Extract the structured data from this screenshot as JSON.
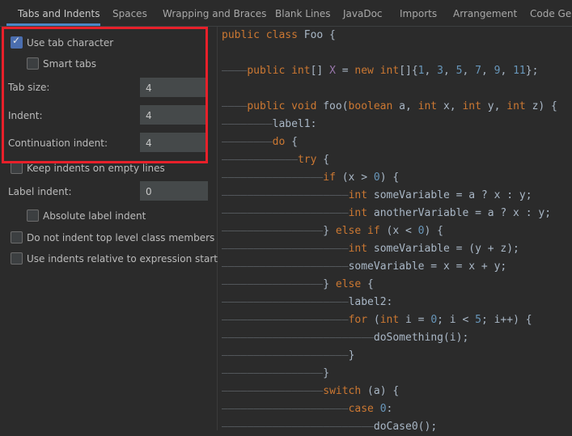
{
  "tabs": [
    {
      "label": "Tabs and Indents",
      "active": true
    },
    {
      "label": "Spaces"
    },
    {
      "label": "Wrapping and Braces"
    },
    {
      "label": "Blank Lines"
    },
    {
      "label": "JavaDoc"
    },
    {
      "label": "Imports"
    },
    {
      "label": "Arrangement"
    },
    {
      "label": "Code Gen"
    }
  ],
  "settings": {
    "use_tab_character": {
      "label": "Use tab character",
      "checked": true
    },
    "smart_tabs": {
      "label": "Smart tabs",
      "checked": false
    },
    "tab_size": {
      "label": "Tab size:",
      "value": "4"
    },
    "indent": {
      "label": "Indent:",
      "value": "4"
    },
    "continuation_indent": {
      "label": "Continuation indent:",
      "value": "4"
    },
    "keep_indents_empty": {
      "label": "Keep indents on empty lines",
      "checked": false
    },
    "label_indent": {
      "label": "Label indent:",
      "value": "0"
    },
    "absolute_label_indent": {
      "label": "Absolute label indent",
      "checked": false
    },
    "no_indent_top_level": {
      "label": "Do not indent top level class members",
      "checked": false
    },
    "indent_relative_expr": {
      "label": "Use indents relative to expression start",
      "checked": false
    }
  },
  "code": {
    "guide": "————",
    "lines": [
      "public class Foo {",
      "",
      "public int[] X = new int[]{1, 3, 5, 7, 9, 11};",
      "",
      "public void foo(boolean a, int x, int y, int z) {",
      "label1:",
      "do {",
      "try {",
      "if (x > 0) {",
      "int someVariable = a ? x : y;",
      "int anotherVariable = a ? x : y;",
      "} else if (x < 0) {",
      "int someVariable = (y + z);",
      "someVariable = x = x + y;",
      "} else {",
      "label2:",
      "for (int i = 0; i < 5; i++) {",
      "doSomething(i);",
      "}",
      "}",
      "switch (a) {",
      "case 0:",
      "doCase0();"
    ]
  }
}
